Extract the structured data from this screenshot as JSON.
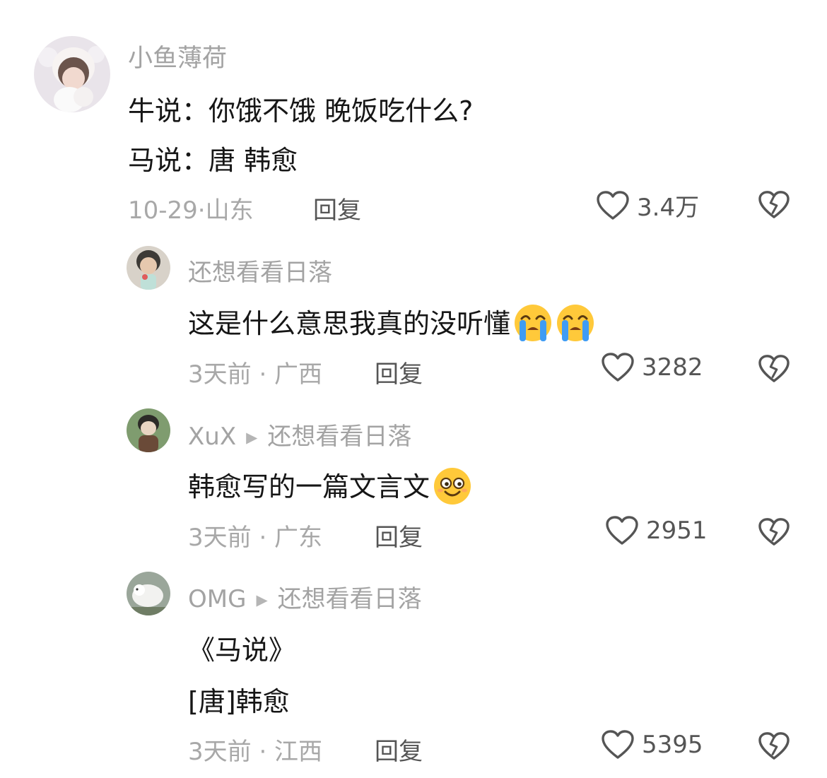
{
  "comments": [
    {
      "username": "小鱼薄荷",
      "lines": [
        "牛说：你饿不饿 晚饭吃什么?",
        "马说：唐 韩愈"
      ],
      "meta": "10-29·山东",
      "reply_label": "回复",
      "likes": "3.4万"
    },
    {
      "username": "还想看看日落",
      "text": "这是什么意思我真的没听懂",
      "emojis": [
        "loudly-crying-face",
        "loudly-crying-face"
      ],
      "meta": "3天前 · 广西",
      "reply_label": "回复",
      "likes": "3282"
    },
    {
      "username": "XuX",
      "reply_to": "还想看看日落",
      "text": "韩愈写的一篇文言文",
      "emojis": [
        "dazed-smiling-face"
      ],
      "meta": "3天前 · 广东",
      "reply_label": "回复",
      "likes": "2951"
    },
    {
      "username": "OMG",
      "reply_to": "还想看看日落",
      "lines": [
        "《马说》",
        "[唐]韩愈"
      ],
      "meta": "3天前 · 江西",
      "reply_label": "回复",
      "likes": "5395"
    }
  ],
  "icons": {
    "like": "heart-outline-icon",
    "dislike": "broken-heart-icon",
    "reply_arrow": "play-triangle-icon"
  },
  "colors": {
    "username": "#a3a3a3",
    "text": "#161616",
    "meta": "#a8a8a8",
    "action": "#555555",
    "emoji_yellow": "#ffc93a",
    "emoji_tear": "#3f9cf4"
  }
}
